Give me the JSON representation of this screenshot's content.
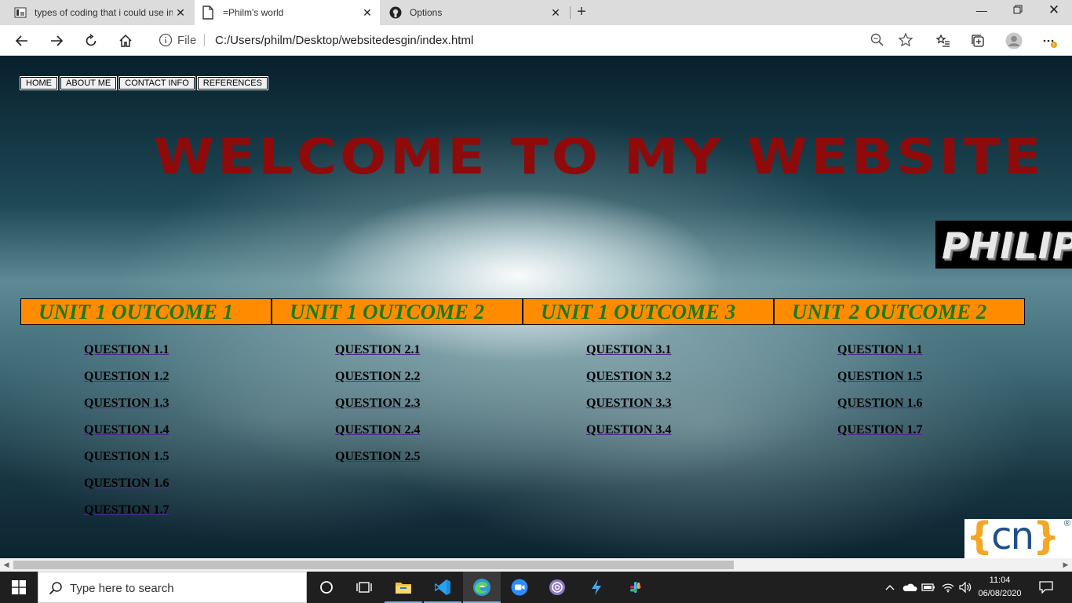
{
  "browser": {
    "tabs": [
      {
        "title": "types of coding that i could use in",
        "icon": "page-favicon-icon",
        "active": false
      },
      {
        "title": "=Philm's world",
        "icon": "document-icon",
        "active": true
      },
      {
        "title": "Options",
        "icon": "github-icon",
        "active": false
      }
    ],
    "address": {
      "scheme_label": "File",
      "url": "C:/Users/philm/Desktop/websitedesgin/index.html"
    }
  },
  "page": {
    "nav": [
      "HOME",
      "ABOUT ME",
      "CONTACT INFO",
      "REFERENCES"
    ],
    "headline": "WELCOME TO MY WEBSITE",
    "logo_text": "PHILIP",
    "outcomes": [
      {
        "title": "UNIT 1 OUTCOME 1",
        "questions": [
          "QUESTION 1.1",
          "QUESTION 1.2",
          "QUESTION 1.3",
          "QUESTION 1.4",
          "QUESTION 1.5",
          "QUESTION 1.6",
          "QUESTION 1.7"
        ]
      },
      {
        "title": "UNIT 1 OUTCOME 2",
        "questions": [
          "QUESTION 2.1",
          "QUESTION 2.2",
          "QUESTION 2.3",
          "QUESTION 2.4",
          "QUESTION 2.5"
        ]
      },
      {
        "title": "UNIT 1 OUTCOME 3",
        "questions": [
          "QUESTION 3.1",
          "QUESTION 3.2",
          "QUESTION 3.3",
          "QUESTION 3.4"
        ]
      },
      {
        "title": "UNIT 2 OUTCOME 2",
        "questions": [
          "QUESTION 1.1",
          "QUESTION 1.5",
          "QUESTION 1.6",
          "QUESTION 1.7"
        ]
      }
    ],
    "overlay_logo": {
      "left": "{",
      "mid": "cn",
      "right": "}",
      "mark": "®"
    }
  },
  "taskbar": {
    "search_placeholder": "Type here to search",
    "time": "11:04",
    "date": "06/08/2020"
  },
  "colors": {
    "outcome_bg": "#ff8c00",
    "outcome_text": "#1f7a10",
    "headline": "#8f0a0a"
  }
}
